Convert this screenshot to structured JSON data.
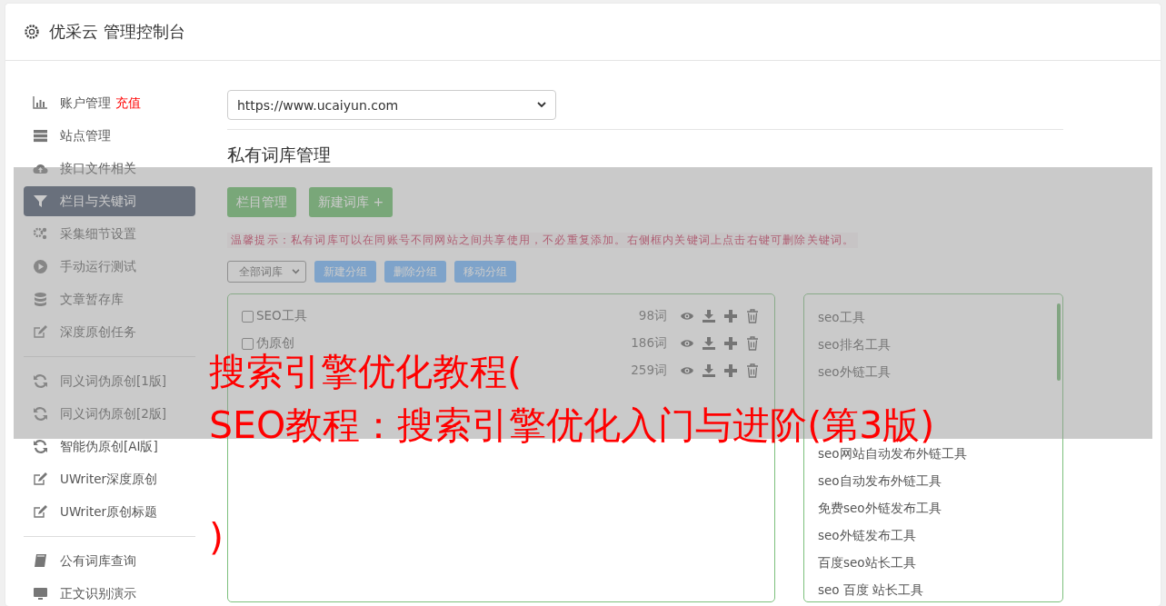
{
  "header": {
    "title": "优采云 管理控制台"
  },
  "sidebar": {
    "groups": [
      {
        "items": [
          {
            "kind": "chart",
            "label": "账户管理",
            "badge": "充值",
            "selected": false
          },
          {
            "kind": "server",
            "label": "站点管理",
            "selected": false
          },
          {
            "kind": "cloud",
            "label": "接口文件相关",
            "selected": false
          },
          {
            "kind": "filter",
            "label": "栏目与关键词",
            "selected": true
          },
          {
            "kind": "gears",
            "label": "采集细节设置",
            "selected": false
          },
          {
            "kind": "play",
            "label": "手动运行测试",
            "selected": false
          },
          {
            "kind": "database",
            "label": "文章暂存库",
            "selected": false
          },
          {
            "kind": "edit",
            "label": "深度原创任务",
            "selected": false
          }
        ]
      },
      {
        "items": [
          {
            "kind": "refresh",
            "label": "同义词伪原创[1版]",
            "selected": false
          },
          {
            "kind": "refresh",
            "label": "同义词伪原创[2版]",
            "selected": false
          },
          {
            "kind": "refresh",
            "label": "智能伪原创[AI版]",
            "selected": false
          },
          {
            "kind": "edit",
            "label": "UWriter深度原创",
            "selected": false
          },
          {
            "kind": "edit",
            "label": "UWriter原创标题",
            "selected": false
          }
        ]
      },
      {
        "items": [
          {
            "kind": "book",
            "label": "公有词库查询",
            "selected": false
          },
          {
            "kind": "monitor",
            "label": "正文识别演示",
            "selected": false
          }
        ]
      }
    ]
  },
  "site_select": {
    "value": "https://www.ucaiyun.com"
  },
  "section_title": "私有词库管理",
  "action_buttons": [
    {
      "label": "栏目管理"
    },
    {
      "label": "新建词库 +"
    }
  ],
  "tip": "温馨提示：私有词库可以在同账号不同网站之间共享使用，不必重复添加。右侧框内关键词上点击右键可删除关键词。",
  "library_filter": {
    "value": "全部词库"
  },
  "group_buttons": [
    {
      "label": "新建分组"
    },
    {
      "label": "删除分组"
    },
    {
      "label": "移动分组"
    }
  ],
  "libraries": [
    {
      "name": "SEO工具",
      "checked": false,
      "count": "98词"
    },
    {
      "name": "伪原创",
      "checked": false,
      "count": "186词"
    },
    {
      "count": "259词"
    }
  ],
  "keywords": [
    {
      "kind": "text",
      "text": "seo工具"
    },
    {
      "kind": "text",
      "text": "seo排名工具"
    },
    {
      "kind": "text",
      "text": "seo外链工具"
    },
    {
      "kind": "covered"
    },
    {
      "kind": "covered"
    },
    {
      "kind": "text",
      "text": "seo网站自动发布外链工具"
    },
    {
      "kind": "text",
      "text": "seo自动发布外链工具"
    },
    {
      "kind": "text",
      "text": "免费seo外链发布工具"
    },
    {
      "kind": "text",
      "text": "seo外链发布工具"
    },
    {
      "kind": "text",
      "text": "百度seo站长工具"
    },
    {
      "kind": "text",
      "text": "seo 百度 站长工具"
    }
  ],
  "overlay": {
    "title_lines": [
      "搜索引擎优化教程(",
      "SEO教程：搜索引擎优化入门与进阶(第3版)",
      ")"
    ]
  }
}
